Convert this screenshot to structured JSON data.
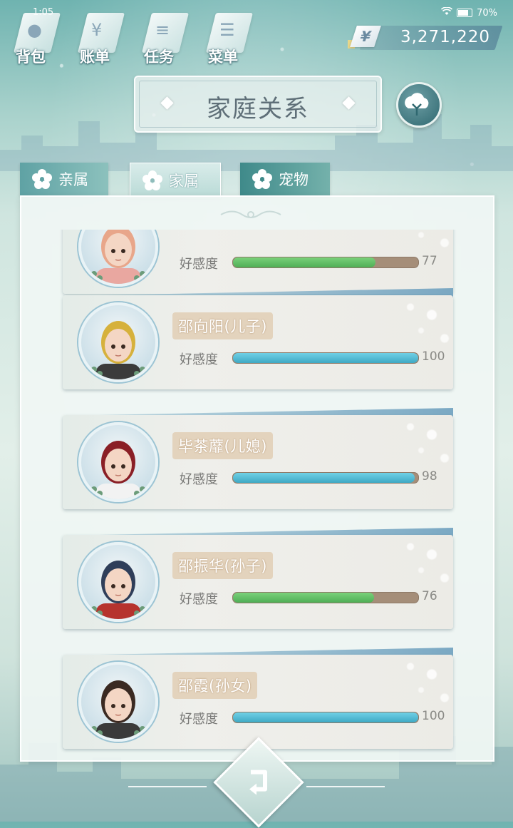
{
  "status": {
    "time": "1:05",
    "battery": "70%"
  },
  "top_menu": [
    {
      "label": "背包",
      "icon": "bag-icon",
      "glyph": "●"
    },
    {
      "label": "账单",
      "icon": "bill-icon",
      "glyph": "¥"
    },
    {
      "label": "任务",
      "icon": "task-icon",
      "glyph": "≡"
    },
    {
      "label": "菜单",
      "icon": "menu-icon",
      "glyph": "☰"
    }
  ],
  "money": {
    "symbol": "¥",
    "value": "3,271,220"
  },
  "title": "家庭关系",
  "tabs": [
    {
      "label": "亲属",
      "active": false
    },
    {
      "label": "家属",
      "active": true
    },
    {
      "label": "宠物",
      "active": false
    }
  ],
  "affection_label": "好感度",
  "members": [
    {
      "name": "",
      "affection": 77,
      "bar_color": "green",
      "hair": "#e8a68a",
      "shirt": "#e9a7a0"
    },
    {
      "name": "邵向阳(儿子)",
      "affection": 100,
      "bar_color": "blue",
      "hair": "#d6b13c",
      "shirt": "#3b3b3b"
    },
    {
      "name": "毕茶蘼(儿媳)",
      "affection": 98,
      "bar_color": "blue",
      "hair": "#8a1f26",
      "shirt": "#f2f2f2"
    },
    {
      "name": "邵振华(孙子)",
      "affection": 76,
      "bar_color": "green",
      "hair": "#2f3e59",
      "shirt": "#b6332e"
    },
    {
      "name": "邵霞(孙女)",
      "affection": 100,
      "bar_color": "blue",
      "hair": "#3b2a22",
      "shirt": "#3a3a3a"
    }
  ],
  "colors": {
    "accent": "#5fa2a4",
    "bar_green": "#5fbf64",
    "bar_blue": "#4fbcd6",
    "bar_track": "#a58e79"
  }
}
